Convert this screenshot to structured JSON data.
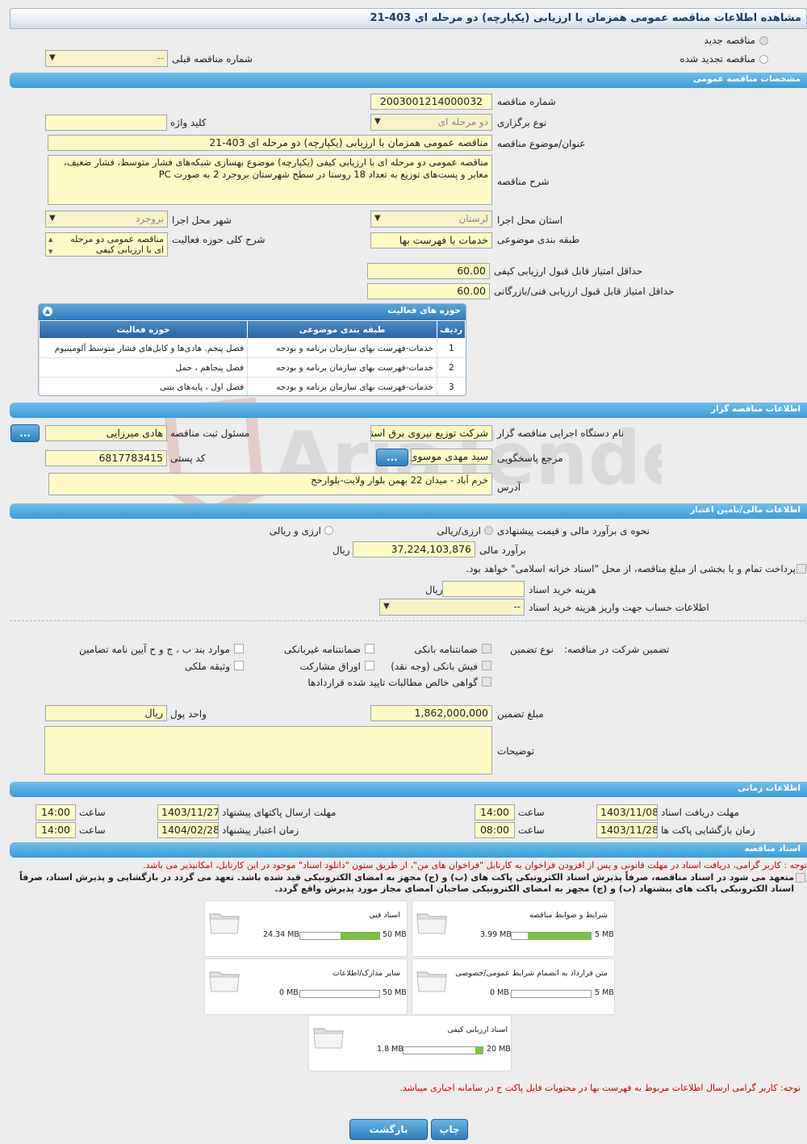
{
  "title": "مشاهده اطلاعات مناقصه عمومی همزمان با ارزیابی (یکپارچه) دو مرحله ای 403-21",
  "top": {
    "radio_new": "مناقصه جدید",
    "radio_renewed": "مناقصه تجدید شده",
    "prev_number_label": "شماره مناقصه قبلی",
    "prev_number_value": "--"
  },
  "sections": {
    "general": "مشخصات مناقصه عمومی",
    "organizer": "اطلاعات مناقصه گزار",
    "financial": "اطلاعات مالی/تامین اعتبار",
    "timing": "اطلاعات زمانی",
    "documents": "اسناد مناقصه"
  },
  "general": {
    "number_label": "شماره مناقصه",
    "number_value": "2003001214000032",
    "type_label": "نوع برگزاری",
    "type_value": "دو مرحله ای",
    "keyword_label": "کلید واژه",
    "keyword_value": "",
    "subject_label": "عنوان/موضوع مناقصه",
    "subject_value": "مناقصه عمومی همزمان با ارزیابی (یکپارچه) دو مرحله ای 403-21",
    "desc_label": "شرح مناقصه",
    "desc_value": "مناقصه عمومی دو مرحله ای با ارزیابی کیفی (یکپارچه) موضوع بهسازی شبکه‌های فشار متوسط، فشار ضعیف، معابر و پست‌های توزیع به تعداد 18 روستا  در سطح شهرستان بروجرد 2 به صورت PC",
    "province_label": "استان محل اجرا",
    "province_value": "لرستان",
    "city_label": "شهر محل اجرا",
    "city_value": "بروجرد",
    "category_label": "طبقه بندی موضوعی",
    "category_value": "خدمات با فهرست بها",
    "activity_desc_label": "شرح کلی حوزه فعالیت",
    "activity_desc_value": "مناقصه عمومی دو مرحله ای با ارزیابی کیفی",
    "min_quality_label": "حداقل امتیاز قابل قبول ارزیابی کیفی",
    "min_quality_value": "60.00",
    "min_tech_label": "حداقل امتیاز قابل قبول ارزیابی فنی/بازرگانی",
    "min_tech_value": "60.00"
  },
  "activity_table": {
    "title": "حوزه های فعالیت",
    "headers": [
      "ردیف",
      "طبقه بندی موضوعی",
      "حوزه فعالیت"
    ],
    "rows": [
      [
        "1",
        "خدمات-فهرست بهای سازمان برنامه و بودجه",
        "فصل پنجم. هادی‌ها و کابل‌های فشار متوسط آلومینیوم"
      ],
      [
        "2",
        "خدمات-فهرست بهای سازمان برنامه و بودجه",
        "فصل پنجاهم ، حمل"
      ],
      [
        "3",
        "خدمات-فهرست بهای سازمان برنامه و بودجه",
        "فصل اول ، پایه‌های بتنی"
      ]
    ]
  },
  "organizer": {
    "org_label": "نام دستگاه اجرایی مناقصه گزار",
    "org_value": "شرکت توزیع نیروی برق استان",
    "registrar_label": "مسئول ثبت مناقصه",
    "registrar_value": "هادی میرزایی",
    "contact_label": "مرجع پاسخگویی",
    "contact_value": "سید مهدی موسوی",
    "postal_label": "کد پستی",
    "postal_value": "6817783415",
    "address_label": "آدرس",
    "address_value": "خرم آباد - میدان 22 بهمن بلوار ولایت-بلوارحج",
    "dots_button": "..."
  },
  "financial": {
    "method_label": "نحوه ی برآورد مالی و قیمت پیشنهادی",
    "opt1": "ارزی/ریالی",
    "opt2": "ارزی و ریالی",
    "estimate_label": "برآورد مالی",
    "estimate_value": "37,224,103,876",
    "rial": "ریال",
    "treasury_text": "پرداخت تمام و یا بخشی از مبلغ مناقصه، از محل \"اسناد خزانه اسلامی\" خواهد بود.",
    "doc_fee_label": "هزینه خرید اسناد",
    "doc_fee_value": "",
    "account_label": "اطلاعات حساب جهت واریز هزینه خرید اسناد",
    "account_value": "--",
    "guarantee_label": "تضمین شرکت در مناقصه:",
    "guarantee_type_label": "نوع تضمین",
    "g1": "ضمانتنامه بانکی",
    "g2": "ضمانتنامه غیربانکی",
    "g3": "موارد بند ب ، ج و ح آیین نامه تضامین",
    "g4": "فیش بانکی (وجه نقد)",
    "g5": "اوراق مشارکت",
    "g6": "وثیقه ملکی",
    "g7": "گواهی خالص مطالبات تایید شده قراردادها",
    "amount_label": "مبلغ تضمین",
    "amount_value": "1,862,000,000",
    "currency_label": "واحد پول",
    "currency_value": "ریال",
    "notes_label": "توضیحات",
    "notes_value": ""
  },
  "timing": {
    "doc_receive_label": "مهلت دریافت اسناد",
    "doc_receive_date": "1403/11/08",
    "doc_receive_time": "14:00",
    "submit_label": "مهلت ارسال پاکتهای پیشنهاد",
    "submit_date": "1403/11/27",
    "submit_time": "14:00",
    "open_label": "زمان بازگشایی پاکت ها",
    "open_date": "1403/11/28",
    "open_time": "08:00",
    "validity_label": "زمان اعتبار پیشنهاد",
    "validity_date": "1404/02/28",
    "validity_time": "14:00",
    "time_label": "ساعت"
  },
  "documents": {
    "note1": "توجه : کاربر گرامی، دریافت اسناد در مهلت قانونی و پس از افزودن فراخوان به کارتابل \"فراخوان های من\"، از طریق ستون \"دانلود اسناد\" موجود در این کارتابل، امکانپذیر می باشد.",
    "note2": "متعهد می شود در اسناد مناقصه، صرفاً پذیرش اسناد الکترونیکی پاکت های (ب) و (ج) مجهز به امضای الکترونیکی قید شده باشد. تعهد می گردد در بازگشایی و پذیرش اسناد، صرفاً اسناد الکترونیکی پاکت های پیشنهاد (ب) و (ج) مجهز به امضای الکترونیکی صاحبان امضای مجاز مورد پذیرش واقع گردد.",
    "files": [
      {
        "name": "شرایط و ضوابط مناقصه",
        "size": "3.99 MB",
        "max": "5 MB",
        "fraction": 0.8
      },
      {
        "name": "اسناد فنی",
        "size": "24.34 MB",
        "max": "50 MB",
        "fraction": 0.49
      },
      {
        "name": "متن قرارداد به انضمام شرایط عمومی/خصوصی",
        "size": "0 MB",
        "max": "5 MB",
        "fraction": 0
      },
      {
        "name": "سایر مدارک/اطلاعات",
        "size": "0 MB",
        "max": "50 MB",
        "fraction": 0
      },
      {
        "name": "اسناد ارزیابی کیفی",
        "size": "1.8 MB",
        "max": "20 MB",
        "fraction": 0.09
      }
    ],
    "note3": "توجه: کاربر گرامی ارسال اطلاعات مربوط به فهرست بها در محتویات فایل پاکت ج در سامانه اجباری میباشد."
  },
  "buttons": {
    "print": "چاپ",
    "back": "بازگشت"
  },
  "watermark": "AriaTender.neT",
  "colors": {
    "section": "#3a9bd8",
    "input": "#fdfbc3",
    "progress": "#7bc53a",
    "note_red": "#d10000"
  }
}
